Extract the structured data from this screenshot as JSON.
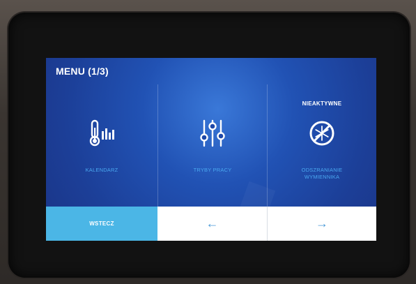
{
  "screen": {
    "title": "MENU (1/3)"
  },
  "tiles": [
    {
      "label": "KALENDARZ",
      "icon": "thermometer-bars-icon",
      "badge": ""
    },
    {
      "label": "TRYBY PRACY",
      "icon": "sliders-icon",
      "badge": ""
    },
    {
      "label": "ODSZRANIANIE\nWYMIENNIKA",
      "icon": "snowflake-disabled-icon",
      "badge": "NIEAKTYWNE"
    }
  ],
  "nav": {
    "back_label": "WSTECZ",
    "prev_arrow": "←",
    "next_arrow": "→"
  },
  "colors": {
    "screen_bg": "#2152b4",
    "label_blue": "#4aa8f0",
    "back_button": "#4bb6e6",
    "arrow": "#4a9ad8"
  }
}
